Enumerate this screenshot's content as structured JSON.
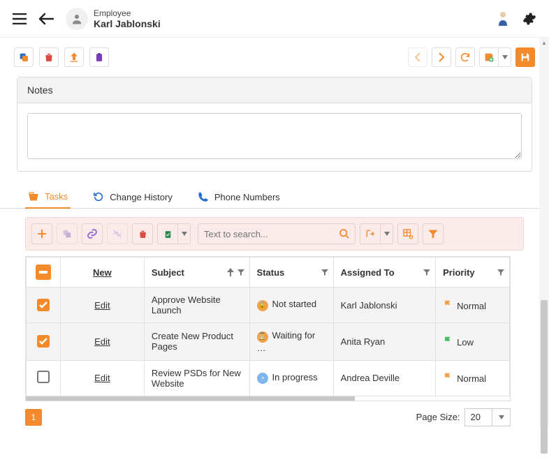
{
  "header": {
    "entity": "Employee",
    "name": "Karl Jablonski"
  },
  "panel": {
    "title": "Notes",
    "notes_value": ""
  },
  "tabs": {
    "tasks": "Tasks",
    "change_history": "Change History",
    "phone_numbers": "Phone Numbers"
  },
  "subtoolbar": {
    "search_placeholder": "Text to search..."
  },
  "table": {
    "headers": {
      "new": "New",
      "subject": "Subject",
      "status": "Status",
      "assigned_to": "Assigned To",
      "priority": "Priority"
    },
    "rows": [
      {
        "checked": true,
        "edit": "Edit",
        "subject": "Approve Website Launch",
        "status": "Not started",
        "status_kind": "ns",
        "assigned_to": "Karl Jablonski",
        "priority": "Normal",
        "priority_color": "#f3a24a"
      },
      {
        "checked": true,
        "edit": "Edit",
        "subject": "Create New Product Pages",
        "status": "Waiting for …",
        "status_kind": "wf",
        "assigned_to": "Anita Ryan",
        "priority": "Low",
        "priority_color": "#4ab86b"
      },
      {
        "checked": false,
        "edit": "Edit",
        "subject": "Review PSDs for New Website",
        "status": "In progress",
        "status_kind": "ip",
        "assigned_to": "Andrea Deville",
        "priority": "Normal",
        "priority_color": "#f3a24a"
      }
    ]
  },
  "pager": {
    "current": "1",
    "page_size_label": "Page Size:",
    "page_size_value": "20"
  }
}
